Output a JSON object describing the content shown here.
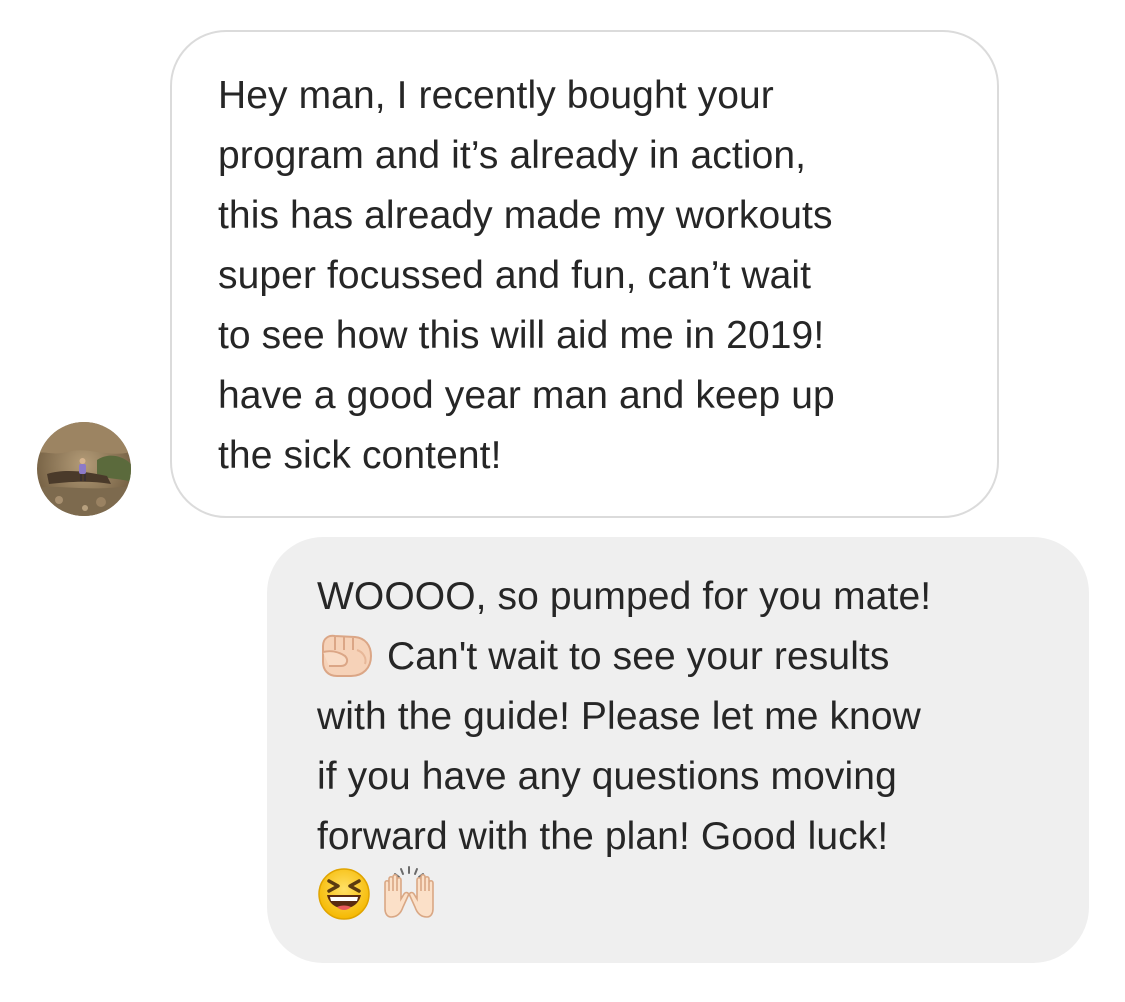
{
  "conversation": {
    "incoming": {
      "lines": [
        "Hey man, I recently bought your",
        "program and it’s already in action,",
        "this has already made my workouts",
        "super focussed and fun, can’t wait",
        "to see how this will aid me in 2019!",
        "have a good year man and keep up",
        "the sick content!"
      ]
    },
    "outgoing": {
      "line1": "WOOOO, so pumped for you mate!",
      "line2_text": "Can't wait to see your results",
      "line2_emoji": "fist-bump-icon",
      "line3": "with the guide! Please let me know",
      "line4": "if you have any questions moving",
      "line5": "forward with the plan! Good luck!",
      "line6_emojis": [
        "laughing-face-icon",
        "raised-hands-icon"
      ]
    }
  },
  "colors": {
    "text": "#262626",
    "incoming_bg": "#ffffff",
    "incoming_border": "#dbdbdb",
    "outgoing_bg": "#efefef"
  }
}
